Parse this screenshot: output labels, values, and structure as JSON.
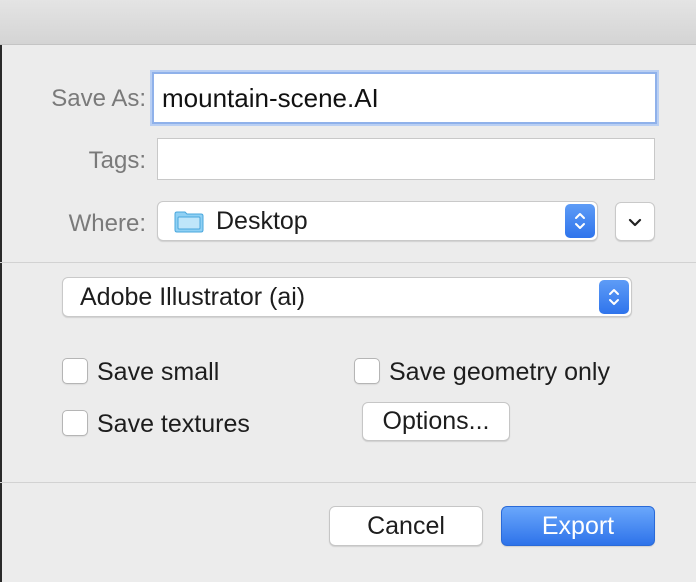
{
  "dialog": {
    "save_as_label": "Save As:",
    "filename_value": "mountain-scene.AI",
    "tags_label": "Tags:",
    "tags_value": "",
    "where_label": "Where:",
    "where_value": "Desktop",
    "where_icon": "folder-icon"
  },
  "format": {
    "selected": "Adobe Illustrator (ai)"
  },
  "options": {
    "save_small": {
      "label": "Save small",
      "checked": false
    },
    "save_textures": {
      "label": "Save textures",
      "checked": false
    },
    "save_geometry_only": {
      "label": "Save geometry only",
      "checked": false
    },
    "options_button": "Options..."
  },
  "footer": {
    "cancel_label": "Cancel",
    "export_label": "Export"
  },
  "colors": {
    "accent": "#2f74ec",
    "focus_ring": "#8fb1ea",
    "folder": "#6cc0ee"
  }
}
